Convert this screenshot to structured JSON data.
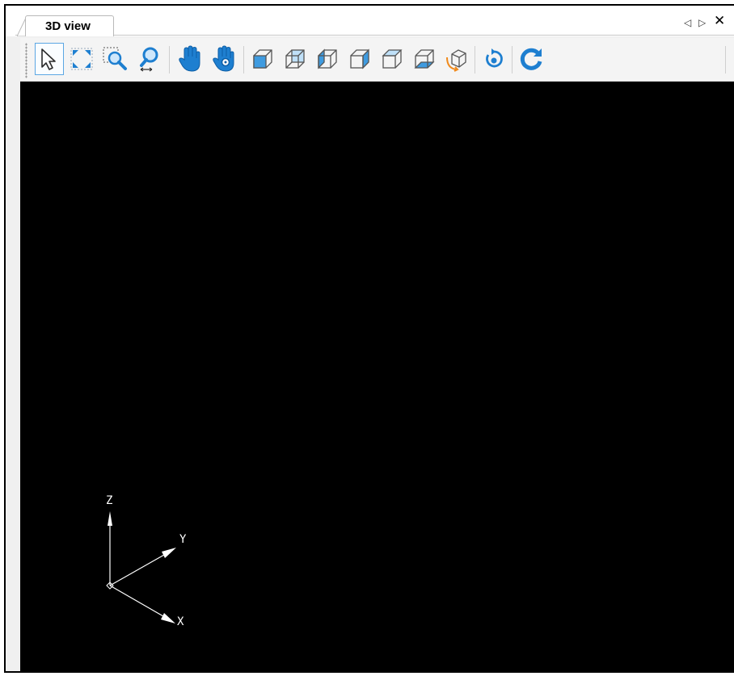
{
  "panel": {
    "tab_title": "3D view",
    "controls": {
      "prev_glyph": "◁",
      "next_glyph": "▷",
      "close_glyph": "✕"
    }
  },
  "toolbar": {
    "tools": [
      {
        "name": "select",
        "icon": "select-arrow-icon",
        "active": true
      },
      {
        "name": "zoom-fit",
        "icon": "zoom-fit-icon"
      },
      {
        "name": "zoom-window",
        "icon": "zoom-window-icon"
      },
      {
        "name": "zoom",
        "icon": "zoom-icon"
      },
      {
        "name": "pan",
        "icon": "pan-hand-icon"
      },
      {
        "name": "pan-alt",
        "icon": "pan-hand-target-icon"
      },
      {
        "name": "view-front",
        "icon": "view-cube-icon"
      },
      {
        "name": "view-back",
        "icon": "view-cube-icon"
      },
      {
        "name": "view-left",
        "icon": "view-cube-icon"
      },
      {
        "name": "view-right",
        "icon": "view-cube-icon"
      },
      {
        "name": "view-top",
        "icon": "view-cube-icon"
      },
      {
        "name": "view-bottom",
        "icon": "view-cube-icon"
      },
      {
        "name": "view-iso",
        "icon": "iso-view-icon"
      },
      {
        "name": "rotate",
        "icon": "rotate-icon"
      },
      {
        "name": "refresh",
        "icon": "refresh-icon"
      }
    ]
  },
  "axes": {
    "x_label": "X",
    "y_label": "Y",
    "z_label": "Z"
  },
  "colors": {
    "accent": "#1e7fd0",
    "viewport_bg": "#000000",
    "axis": "#ffffff"
  }
}
